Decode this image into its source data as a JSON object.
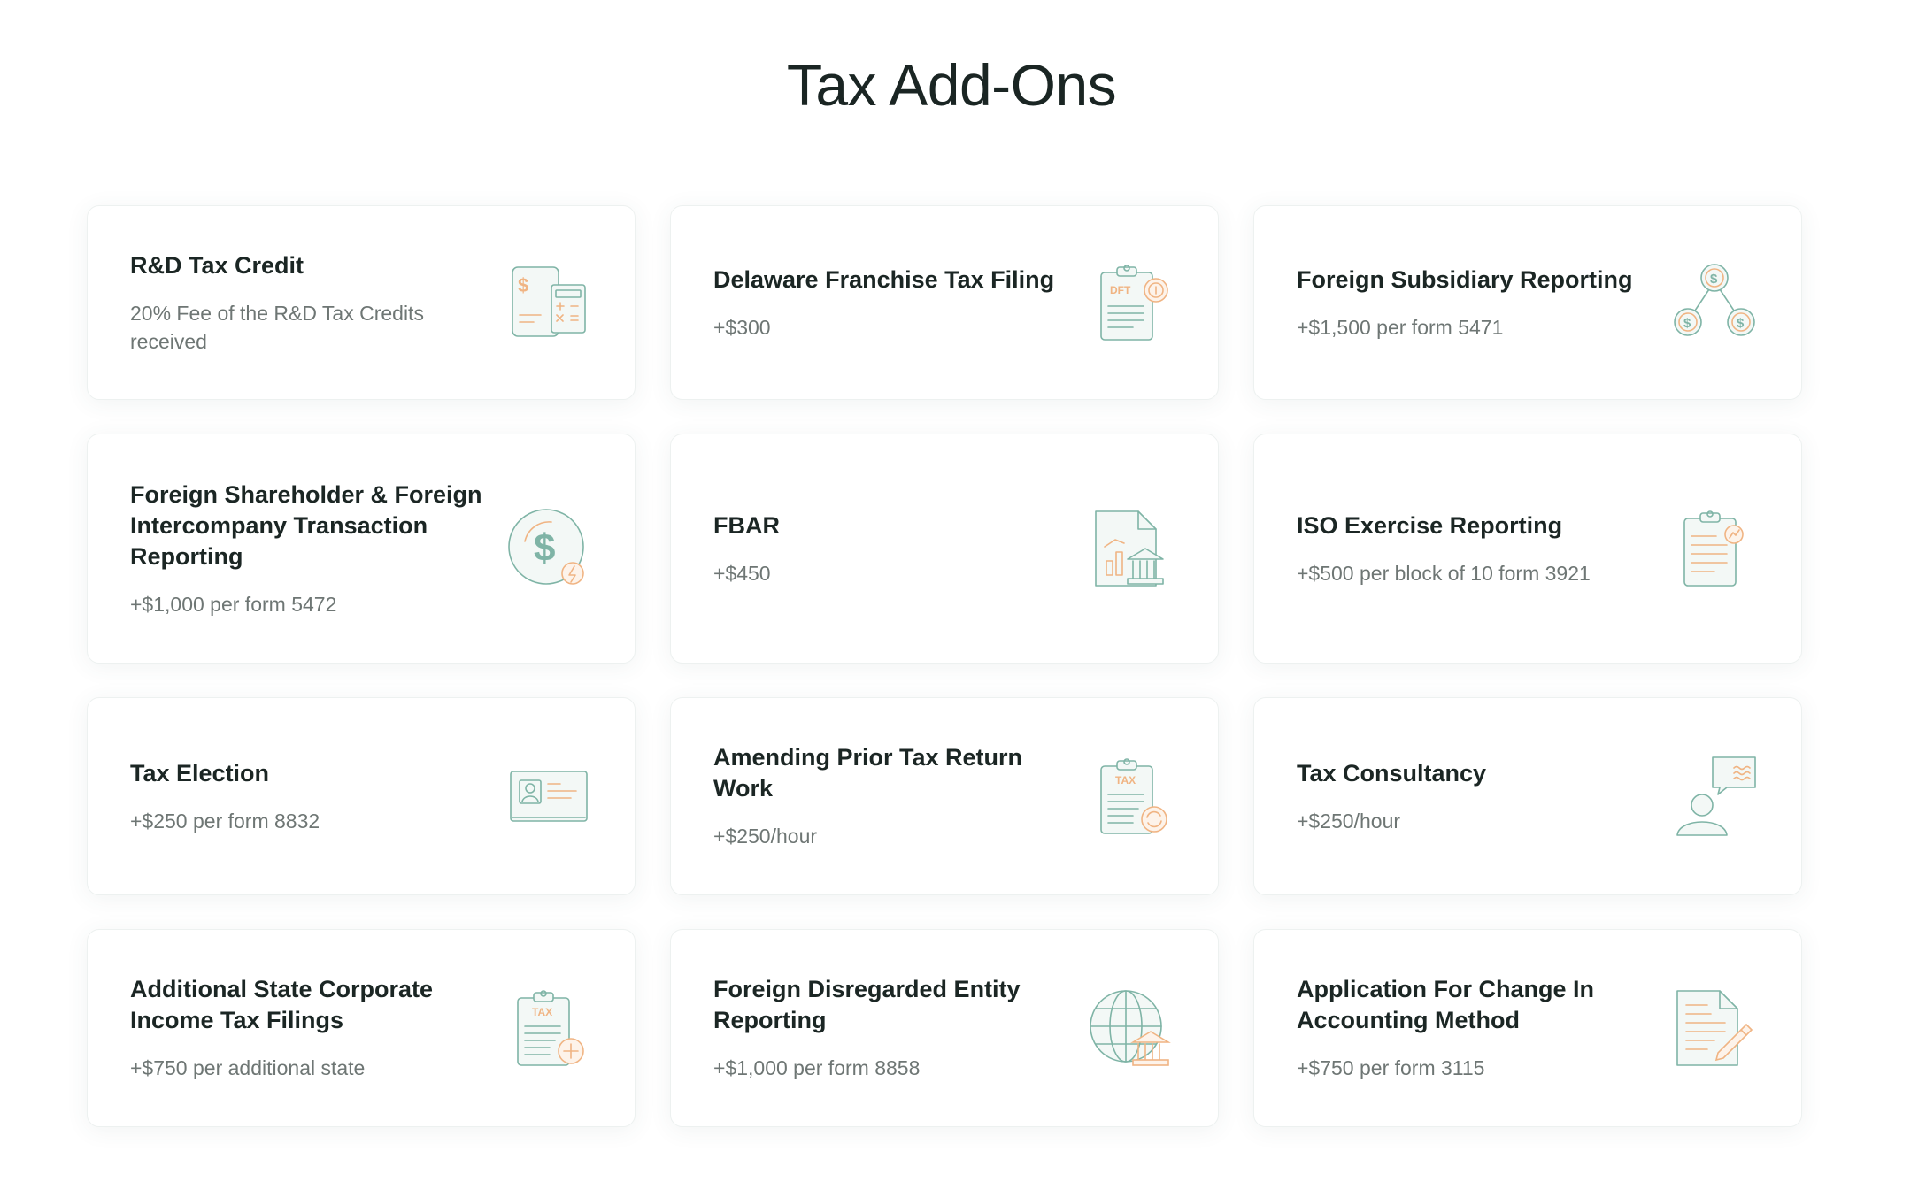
{
  "page": {
    "title": "Tax Add-Ons"
  },
  "cards": [
    {
      "title": "R&D Tax Credit",
      "price": "20% Fee of the R&D Tax Credits received",
      "icon": "tax-calculator-icon"
    },
    {
      "title": "Delaware Franchise Tax Filing",
      "price": "+$300",
      "icon": "dft-clipboard-icon"
    },
    {
      "title": "Foreign Subsidiary Reporting",
      "price": "+$1,500 per form 5471",
      "icon": "subsidiary-network-icon"
    },
    {
      "title": "Foreign Shareholder & Foreign Intercompany Transaction Reporting",
      "price": "+$1,000 per form 5472",
      "icon": "dollar-coin-icon"
    },
    {
      "title": "FBAR",
      "price": "+$450",
      "icon": "bank-report-icon"
    },
    {
      "title": "ISO Exercise Reporting",
      "price": "+$500 per block of 10 form 3921",
      "icon": "stock-clipboard-icon"
    },
    {
      "title": "Tax Election",
      "price": "+$250 per form 8832",
      "icon": "id-card-icon"
    },
    {
      "title": "Amending Prior Tax Return Work",
      "price": "+$250/hour",
      "icon": "tax-amend-clipboard-icon"
    },
    {
      "title": "Tax Consultancy",
      "price": "+$250/hour",
      "icon": "consultant-chat-icon"
    },
    {
      "title": "Additional State Corporate Income Tax Filings",
      "price": "+$750 per additional state",
      "icon": "tax-add-clipboard-icon"
    },
    {
      "title": "Foreign Disregarded Entity Reporting",
      "price": "+$1,000 per form 8858",
      "icon": "globe-bank-icon"
    },
    {
      "title": "Application For Change In Accounting Method",
      "price": "+$750 per form 3115",
      "icon": "document-pencil-icon"
    }
  ],
  "icon_text": {
    "dft": "DFT",
    "tax": "TAX",
    "dollar": "$"
  },
  "colors": {
    "icon_green": "#7fb4a6",
    "icon_orange": "#f0b483",
    "subtitle": "#6e7674",
    "title": "#1b2624"
  }
}
